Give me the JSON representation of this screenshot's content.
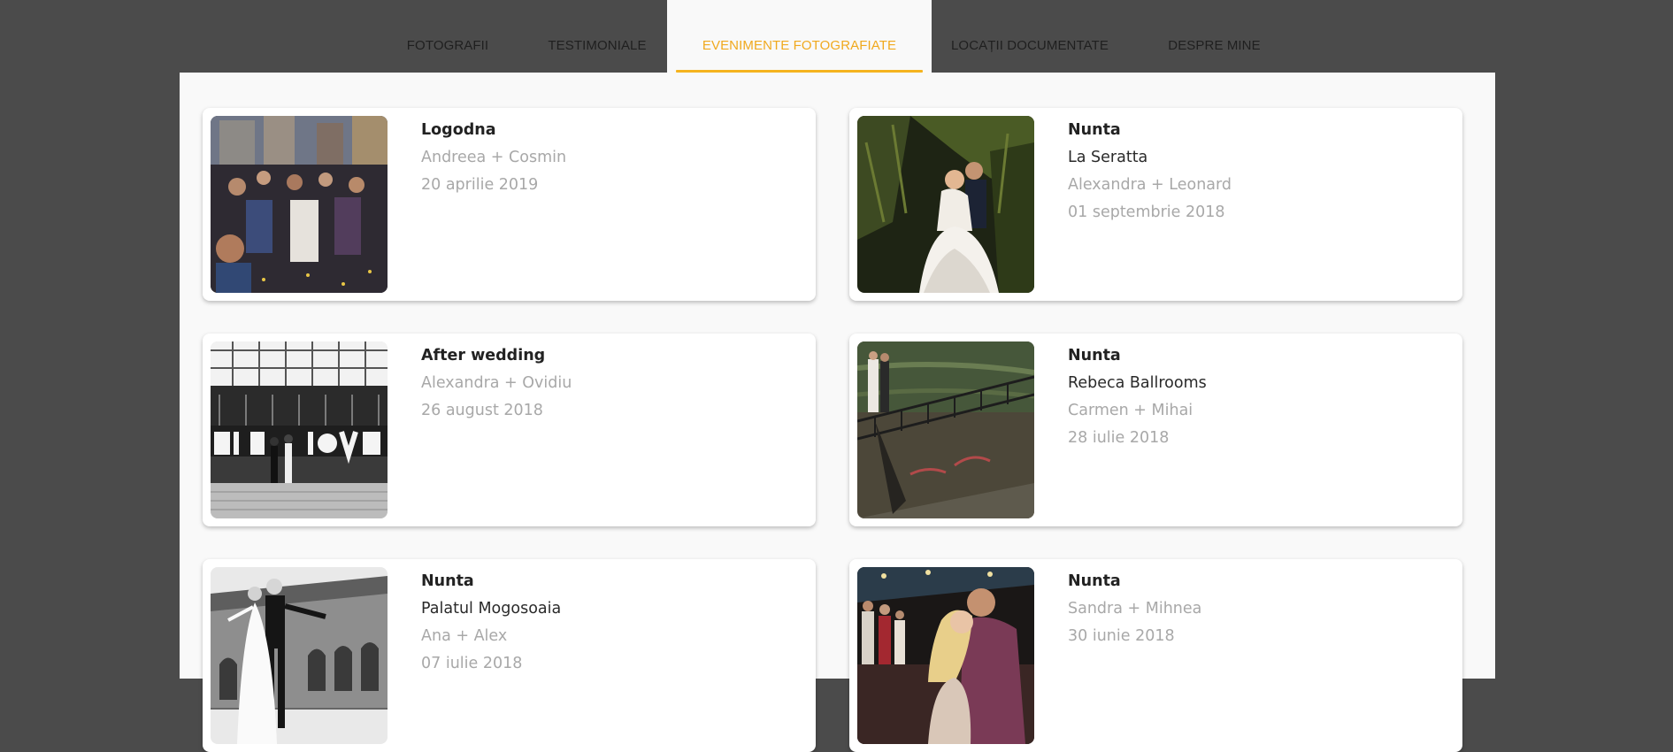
{
  "nav": {
    "tabs": [
      {
        "label": "FOTOGRAFII",
        "active": false
      },
      {
        "label": "TESTIMONIALE",
        "active": false
      },
      {
        "label": "EVENIMENTE FOTOGRAFIATE",
        "active": true
      },
      {
        "label": "LOCAȚII DOCUMENTATE",
        "active": false
      },
      {
        "label": "DESPRE MINE",
        "active": false
      }
    ]
  },
  "events": [
    {
      "type": "Logodna",
      "couple": "Andreea + Cosmin",
      "date": "20 aprilie 2019",
      "photo": "crowd-street-dance-photo"
    },
    {
      "type": "Nunta",
      "venue": "La Seratta",
      "couple": "Alexandra + Leonard",
      "date": "01 septembrie 2018",
      "photo": "couple-in-foliage-photo"
    },
    {
      "type": "After wedding",
      "couple": "Alexandra + Ovidiu",
      "date": "26 august 2018",
      "photo": "love-sign-bw-photo"
    },
    {
      "type": "Nunta",
      "venue": "Rebeca Ballrooms",
      "couple": "Carmen + Mihai",
      "date": "28 iulie 2018",
      "photo": "lakeside-railing-photo"
    },
    {
      "type": "Nunta",
      "venue": "Palatul Mogosoaia",
      "couple": "Ana + Alex",
      "date": "07 iulie 2018",
      "photo": "palace-dance-bw-photo"
    },
    {
      "type": "Nunta",
      "couple": "Sandra + Mihnea",
      "date": "30 iunie 2018",
      "photo": "party-kiss-photo"
    }
  ],
  "colors": {
    "accent": "#f5b41f",
    "active_tab_text": "#f0a91e",
    "backdrop": "#4b4b4b",
    "panel": "#f9f9f9",
    "muted_text": "#a8a8a8"
  }
}
